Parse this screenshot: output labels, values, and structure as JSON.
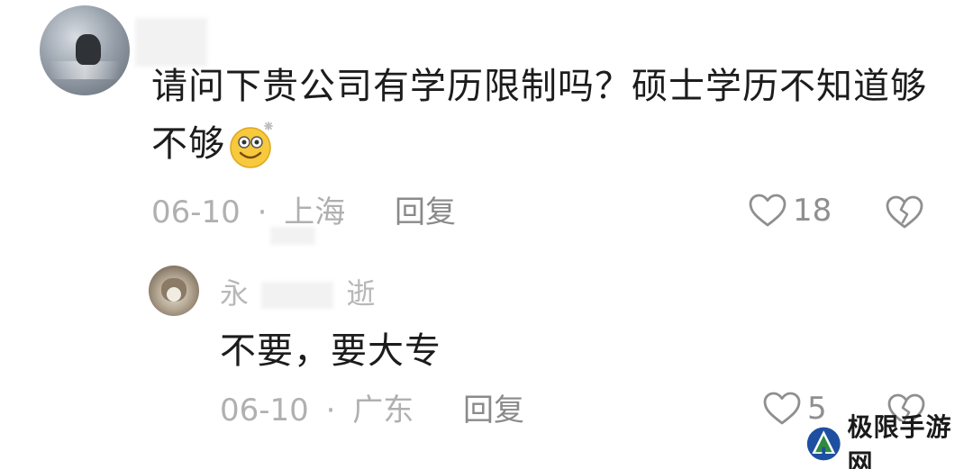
{
  "comment": {
    "text_line1": "请问下贵公司有学历限制吗？硕士学历不知道够",
    "text_line2": "不够",
    "emoji_icon": "smile-emoji-icon",
    "date": "06-10",
    "separator": "·",
    "location": "上海",
    "reply_label": "回复",
    "like_count": "18"
  },
  "reply": {
    "author_visible_start": "永",
    "author_visible_end": "逝",
    "text": "不要，要大专",
    "date": "06-10",
    "separator": "·",
    "location": "广东",
    "reply_label": "回复",
    "like_count": "5"
  },
  "watermark": {
    "text": "极限手游网"
  },
  "colors": {
    "text_primary": "#1c1c1c",
    "text_meta": "#b0b0b0",
    "icon_gray": "#8f8f8f",
    "watermark_green": "#2e8b3d",
    "watermark_blue": "#1f4fa0"
  }
}
